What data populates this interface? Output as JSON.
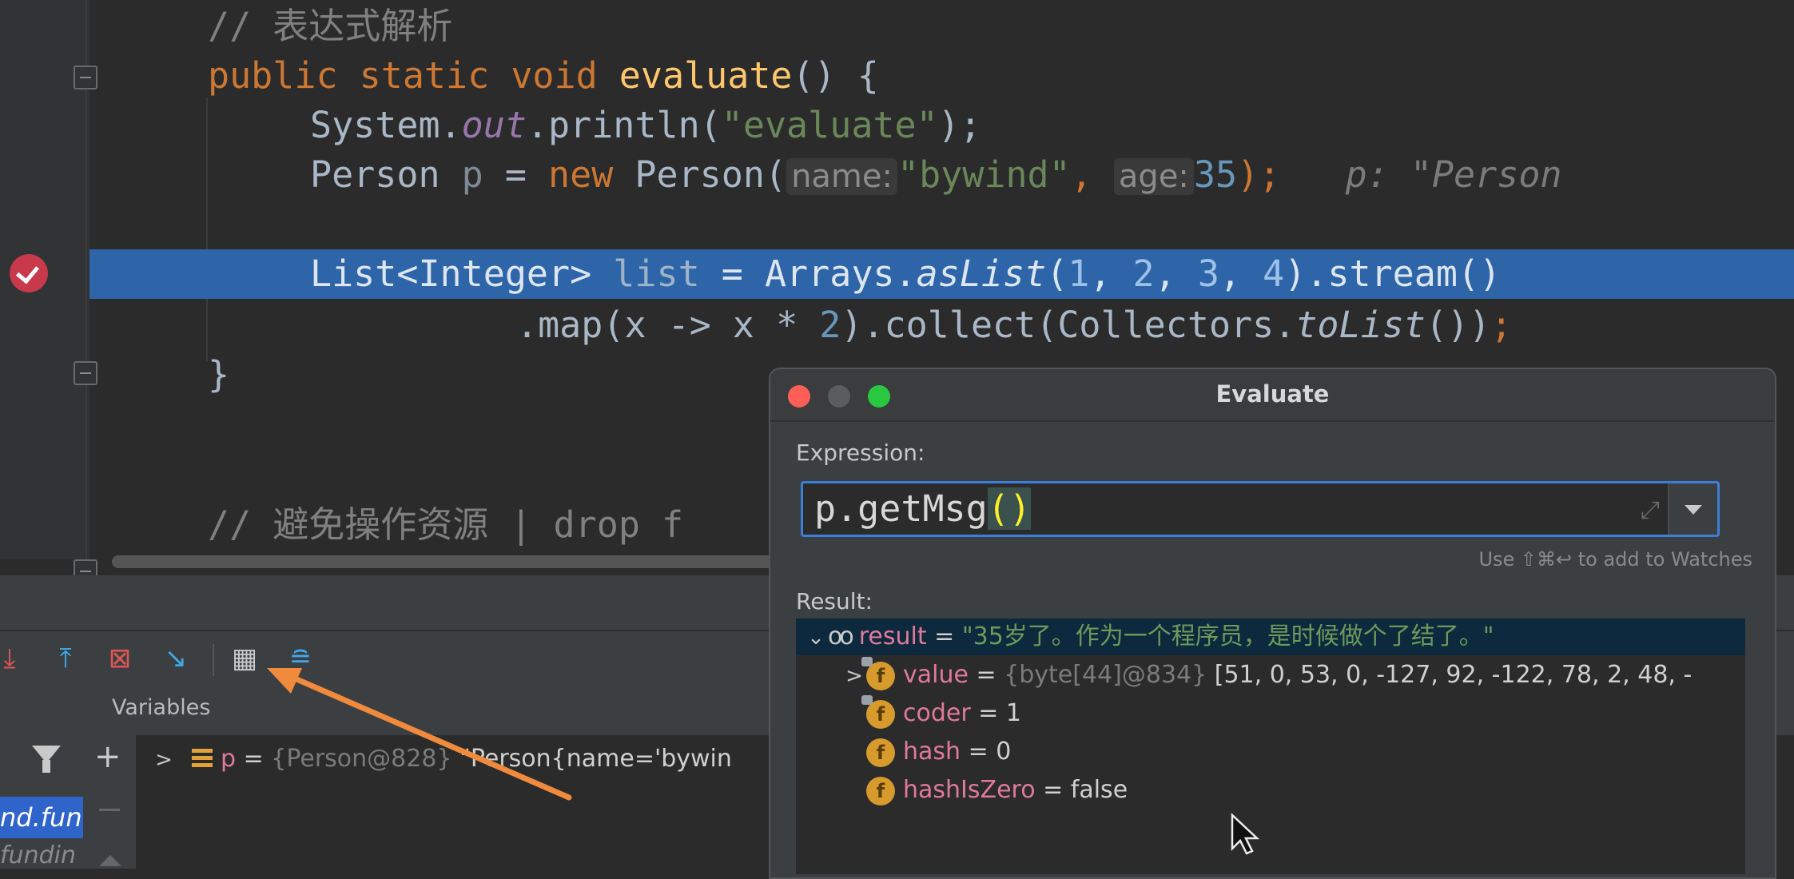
{
  "editor": {
    "lines": [
      {
        "comment": "// 表达式解析"
      },
      {
        "kw1": "public",
        "kw2": "static",
        "kw3": "void",
        "name": "evaluate",
        "rest": "() {"
      },
      {
        "a": "System.",
        "field": "out",
        "b": ".println(",
        "str": "\"evaluate\"",
        "c": ");"
      },
      {
        "a": "Person ",
        "var": "p",
        "b": " = ",
        "kw": "new",
        "c": " Person(",
        "hint1": "name:",
        "str": "\"bywind\"",
        "d": ", ",
        "hint2": "age:",
        "num": "35",
        "e": ");",
        "inline": "p: \"Person"
      },
      {
        "a": "List<Integer> ",
        "var": "list",
        "b": " = Arrays.",
        "method": "asList",
        "c": "(",
        "n1": "1",
        "n2": "2",
        "n3": "3",
        "n4": "4",
        "d": ").stream()"
      },
      {
        "a": ".map(x -> x * ",
        "num": "2",
        "b": ").collect(Collectors.",
        "method": "toList",
        "c": "())",
        "semi": ";"
      },
      {
        "text": "}"
      },
      {
        "comment": "// 避免操作资源 | drop f"
      }
    ]
  },
  "debugger": {
    "variables_label": "Variables",
    "var_row": {
      "name": "p",
      "eq": " = ",
      "ref": "{Person@828}",
      "value": "\"Person{name='bywin"
    },
    "frames": {
      "selected": "nd.func",
      "next": "fundin"
    },
    "toolbar_icons": [
      "step-out-icon",
      "step-up-icon",
      "drop-frame-icon",
      "run-to-cursor-icon",
      "evaluate-expression-icon",
      "trace-icon"
    ],
    "add_icon": "+"
  },
  "evaluate_dialog": {
    "title": "Evaluate",
    "expression_label": "Expression:",
    "expression_value": "p.getMsg",
    "expression_parens": "()",
    "watch_hint": "Use ⇧⌘↩ to add to Watches",
    "result_label": "Result:",
    "result": {
      "name": "result",
      "eq": " = ",
      "value": "\"35岁了。作为一个程序员，是时候做个了结了。\""
    },
    "fields": [
      {
        "badge": "f",
        "name": "value",
        "eq": " = ",
        "ref": "{byte[44]@834}",
        "value": " [51, 0, 53, 0, -127, 92, -122, 78, 2, 48, -"
      },
      {
        "badge": "f",
        "name": "coder",
        "eq": " = ",
        "value": "1"
      },
      {
        "badge": "f",
        "name": "hash",
        "eq": " = ",
        "value": "0"
      },
      {
        "badge": "f",
        "name": "hashIsZero",
        "eq": " = ",
        "value": "false"
      }
    ]
  },
  "colors": {
    "accent": "#2d65a8",
    "breakpoint": "#c7394b",
    "annotation_arrow": "#f08a3c",
    "badge": "#d69b2c"
  }
}
